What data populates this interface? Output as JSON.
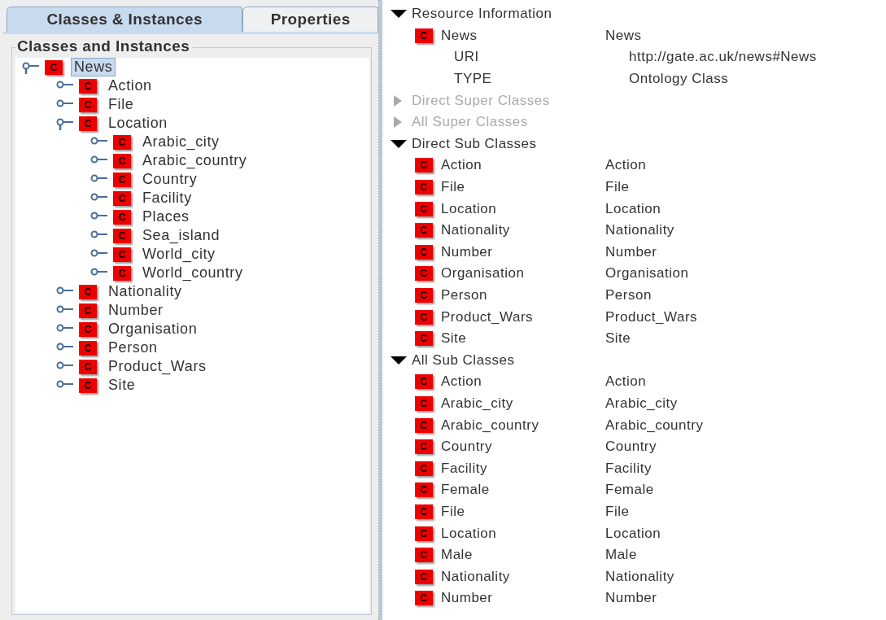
{
  "tabs": [
    {
      "label": "Classes & Instances",
      "selected": true
    },
    {
      "label": "Properties",
      "selected": false
    }
  ],
  "tree_panel": {
    "title": "Classes and Instances",
    "tree": [
      {
        "label": "News",
        "icon": "C",
        "expanded": true,
        "selected": true,
        "children": [
          {
            "label": "Action",
            "icon": "C",
            "expanded": false,
            "selected": false
          },
          {
            "label": "File",
            "icon": "C",
            "expanded": false,
            "selected": false
          },
          {
            "label": "Location",
            "icon": "C",
            "expanded": true,
            "selected": false,
            "children": [
              {
                "label": "Arabic_city",
                "icon": "C",
                "expanded": false,
                "selected": false
              },
              {
                "label": "Arabic_country",
                "icon": "C",
                "expanded": false,
                "selected": false
              },
              {
                "label": "Country",
                "icon": "C",
                "expanded": false,
                "selected": false
              },
              {
                "label": "Facility",
                "icon": "C",
                "expanded": false,
                "selected": false
              },
              {
                "label": "Places",
                "icon": "C",
                "expanded": false,
                "selected": false
              },
              {
                "label": "Sea_island",
                "icon": "C",
                "expanded": false,
                "selected": false
              },
              {
                "label": "World_city",
                "icon": "C",
                "expanded": false,
                "selected": false
              },
              {
                "label": "World_country",
                "icon": "C",
                "expanded": false,
                "selected": false
              }
            ]
          },
          {
            "label": "Nationality",
            "icon": "C",
            "expanded": false,
            "selected": false
          },
          {
            "label": "Number",
            "icon": "C",
            "expanded": false,
            "selected": false
          },
          {
            "label": "Organisation",
            "icon": "C",
            "expanded": false,
            "selected": false
          },
          {
            "label": "Person",
            "icon": "C",
            "expanded": false,
            "selected": false
          },
          {
            "label": "Product_Wars",
            "icon": "C",
            "expanded": false,
            "selected": false
          },
          {
            "label": "Site",
            "icon": "C",
            "expanded": false,
            "selected": false
          }
        ]
      }
    ]
  },
  "details": [
    {
      "title": "Resource Information",
      "expanded": true,
      "disabled": false,
      "rows": [
        {
          "kind": "class",
          "icon": "C",
          "name": "News",
          "value": "News"
        },
        {
          "kind": "property",
          "name": "URI",
          "value": "http://gate.ac.uk/news#News"
        },
        {
          "kind": "property",
          "name": "TYPE",
          "value": "Ontology Class"
        }
      ]
    },
    {
      "title": "Direct Super Classes",
      "expanded": false,
      "disabled": true
    },
    {
      "title": "All Super Classes",
      "expanded": false,
      "disabled": true
    },
    {
      "title": "Direct Sub Classes",
      "expanded": true,
      "disabled": false,
      "rows": [
        {
          "kind": "class",
          "icon": "C",
          "name": "Action",
          "value": "Action"
        },
        {
          "kind": "class",
          "icon": "C",
          "name": "File",
          "value": "File"
        },
        {
          "kind": "class",
          "icon": "C",
          "name": "Location",
          "value": "Location"
        },
        {
          "kind": "class",
          "icon": "C",
          "name": "Nationality",
          "value": "Nationality"
        },
        {
          "kind": "class",
          "icon": "C",
          "name": "Number",
          "value": "Number"
        },
        {
          "kind": "class",
          "icon": "C",
          "name": "Organisation",
          "value": "Organisation"
        },
        {
          "kind": "class",
          "icon": "C",
          "name": "Person",
          "value": "Person"
        },
        {
          "kind": "class",
          "icon": "C",
          "name": "Product_Wars",
          "value": "Product_Wars"
        },
        {
          "kind": "class",
          "icon": "C",
          "name": "Site",
          "value": "Site"
        }
      ]
    },
    {
      "title": "All Sub Classes",
      "expanded": true,
      "disabled": false,
      "rows": [
        {
          "kind": "class",
          "icon": "C",
          "name": "Action",
          "value": "Action"
        },
        {
          "kind": "class",
          "icon": "C",
          "name": "Arabic_city",
          "value": "Arabic_city"
        },
        {
          "kind": "class",
          "icon": "C",
          "name": "Arabic_country",
          "value": "Arabic_country"
        },
        {
          "kind": "class",
          "icon": "C",
          "name": "Country",
          "value": "Country"
        },
        {
          "kind": "class",
          "icon": "C",
          "name": "Facility",
          "value": "Facility"
        },
        {
          "kind": "class",
          "icon": "C",
          "name": "Female",
          "value": "Female"
        },
        {
          "kind": "class",
          "icon": "C",
          "name": "File",
          "value": "File"
        },
        {
          "kind": "class",
          "icon": "C",
          "name": "Location",
          "value": "Location"
        },
        {
          "kind": "class",
          "icon": "C",
          "name": "Male",
          "value": "Male"
        },
        {
          "kind": "class",
          "icon": "C",
          "name": "Nationality",
          "value": "Nationality"
        },
        {
          "kind": "class",
          "icon": "C",
          "name": "Number",
          "value": "Number"
        }
      ]
    }
  ]
}
